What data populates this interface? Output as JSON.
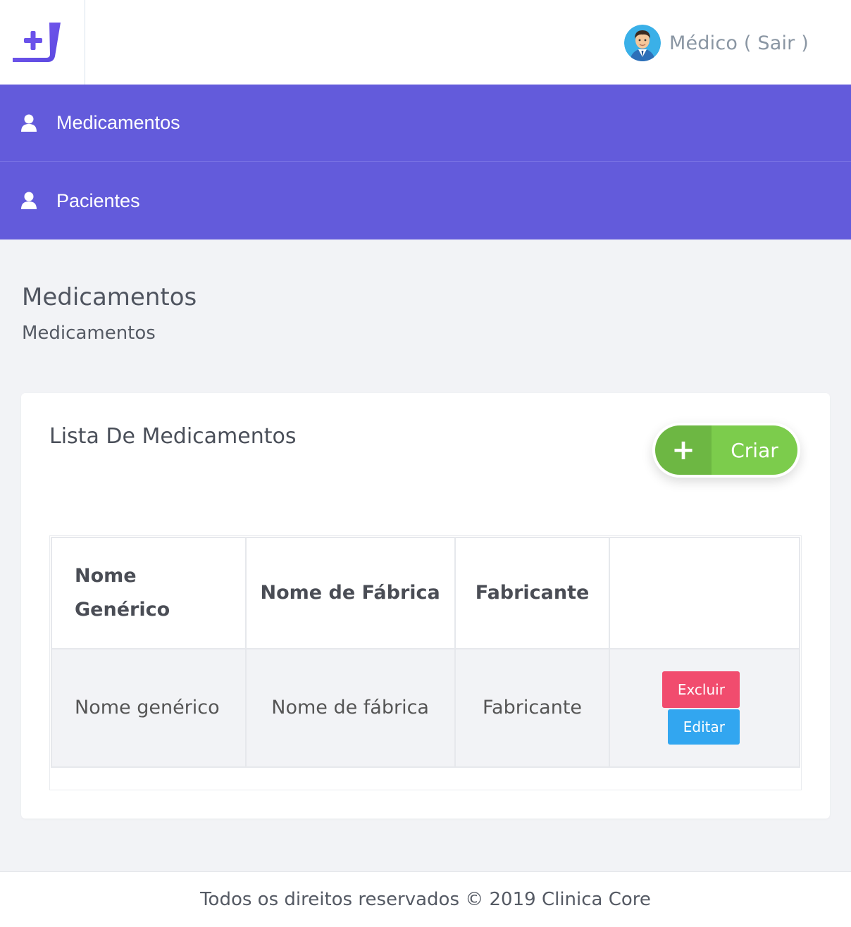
{
  "header": {
    "user_label": "Médico ( Sair )"
  },
  "nav": {
    "items": [
      {
        "label": "Medicamentos",
        "icon": "user-icon"
      },
      {
        "label": "Pacientes",
        "icon": "user-icon"
      }
    ]
  },
  "page": {
    "title": "Medicamentos",
    "breadcrumb": "Medicamentos"
  },
  "card": {
    "title": "Lista De Medicamentos",
    "create_label": "Criar",
    "create_icon": "plus-icon"
  },
  "table": {
    "headers": [
      "Nome Genérico",
      "Nome de Fábrica",
      "Fabricante",
      ""
    ],
    "rows": [
      {
        "generic_name": "Nome genérico",
        "brand_name": "Nome de fábrica",
        "manufacturer": "Fabricante",
        "delete_label": "Excluir",
        "edit_label": "Editar"
      }
    ]
  },
  "footer": {
    "text": "Todos os direitos reservados © 2019 Clinica Core"
  },
  "colors": {
    "nav_bg": "#635bdb",
    "create_green": "#7ccc4c",
    "delete_red": "#f14c6e",
    "edit_blue": "#32a6f0"
  }
}
